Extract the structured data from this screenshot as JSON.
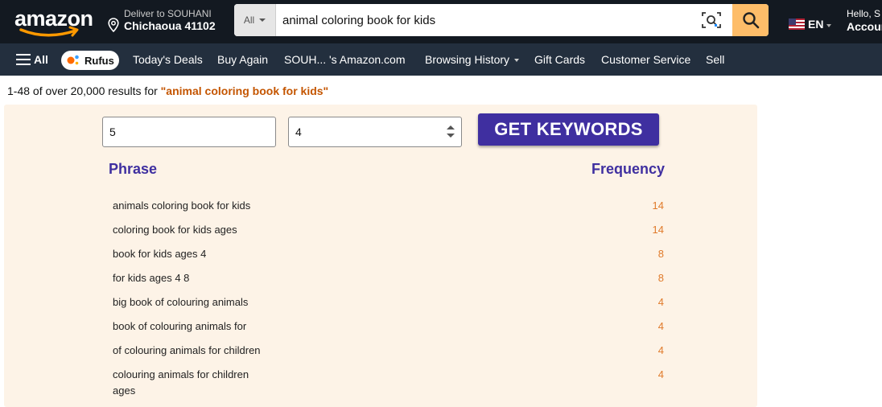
{
  "header": {
    "logo_text": "amazon",
    "deliver_line1": "Deliver to SOUHANI",
    "deliver_line2": "Chichaoua 41102",
    "search_category": "All",
    "search_value": "animal coloring book for kids",
    "language": "EN",
    "account_line1": "Hello, S",
    "account_line2": "Accoun"
  },
  "nav": {
    "all": "All",
    "rufus": "Rufus",
    "links": [
      "Today's Deals",
      "Buy Again",
      "SOUH... 's Amazon.com",
      "Browsing History",
      "Gift Cards",
      "Customer Service",
      "Sell"
    ]
  },
  "results": {
    "prefix": "1-48 of over 20,000 results for ",
    "query": "\"animal coloring book for kids\""
  },
  "tool": {
    "input1_value": "5",
    "input2_value": "4",
    "button_label": "GET KEYWORDS",
    "phrase_header": "Phrase",
    "frequency_header": "Frequency",
    "rows": [
      {
        "phrase": "animals coloring book for kids",
        "frequency": "14"
      },
      {
        "phrase": "coloring book for kids ages",
        "frequency": "14"
      },
      {
        "phrase": "book for kids ages 4",
        "frequency": "8"
      },
      {
        "phrase": "for kids ages 4 8",
        "frequency": "8"
      },
      {
        "phrase": "big book of colouring animals",
        "frequency": "4"
      },
      {
        "phrase": "book of colouring animals for",
        "frequency": "4"
      },
      {
        "phrase": "of colouring animals for children",
        "frequency": "4"
      },
      {
        "phrase": "colouring animals for children ages",
        "frequency": "4"
      }
    ]
  },
  "colors": {
    "header_bg": "#131921",
    "nav_bg": "#232f3e",
    "search_button": "#febd69",
    "panel_bg": "#fdf3e7",
    "accent_purple": "#3f2fa0",
    "frequency_orange": "#e07a2a",
    "query_orange": "#c45500"
  },
  "icons": {
    "logo_smile": "amazon-smile-arrow",
    "location": "map-pin-icon",
    "visual_search": "camera-lens-icon",
    "search": "magnifier-icon",
    "flag": "us-flag-icon",
    "menu": "hamburger-icon",
    "rufus": "rufus-dots-icon"
  }
}
